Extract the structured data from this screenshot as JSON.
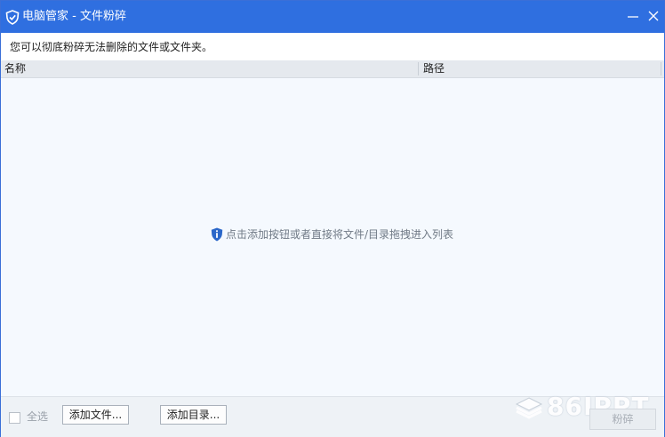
{
  "window": {
    "title": "电脑管家 - 文件粉碎",
    "description": "您可以彻底粉碎无法删除的文件或文件夹。"
  },
  "list": {
    "columns": [
      "名称",
      "路径"
    ],
    "empty_hint": "点击添加按钮或者直接将文件/目录拖拽进入列表"
  },
  "footer": {
    "select_all_label": "全选",
    "add_file_label": "添加文件...",
    "add_dir_label": "添加目录...",
    "shred_label": "粉碎",
    "watermark_text": "86IPPT"
  },
  "icons": {
    "app": "shield-check-icon",
    "minimize": "minimize-icon",
    "close": "close-icon",
    "info": "info-icon",
    "watermark": "layers-logo-icon"
  },
  "colors": {
    "titlebar": "#2f6fe0",
    "body_bg": "#f5f9fe",
    "header_bg": "#e5e9ee",
    "hint_text": "#707a86",
    "info_icon": "#2a67c9"
  }
}
